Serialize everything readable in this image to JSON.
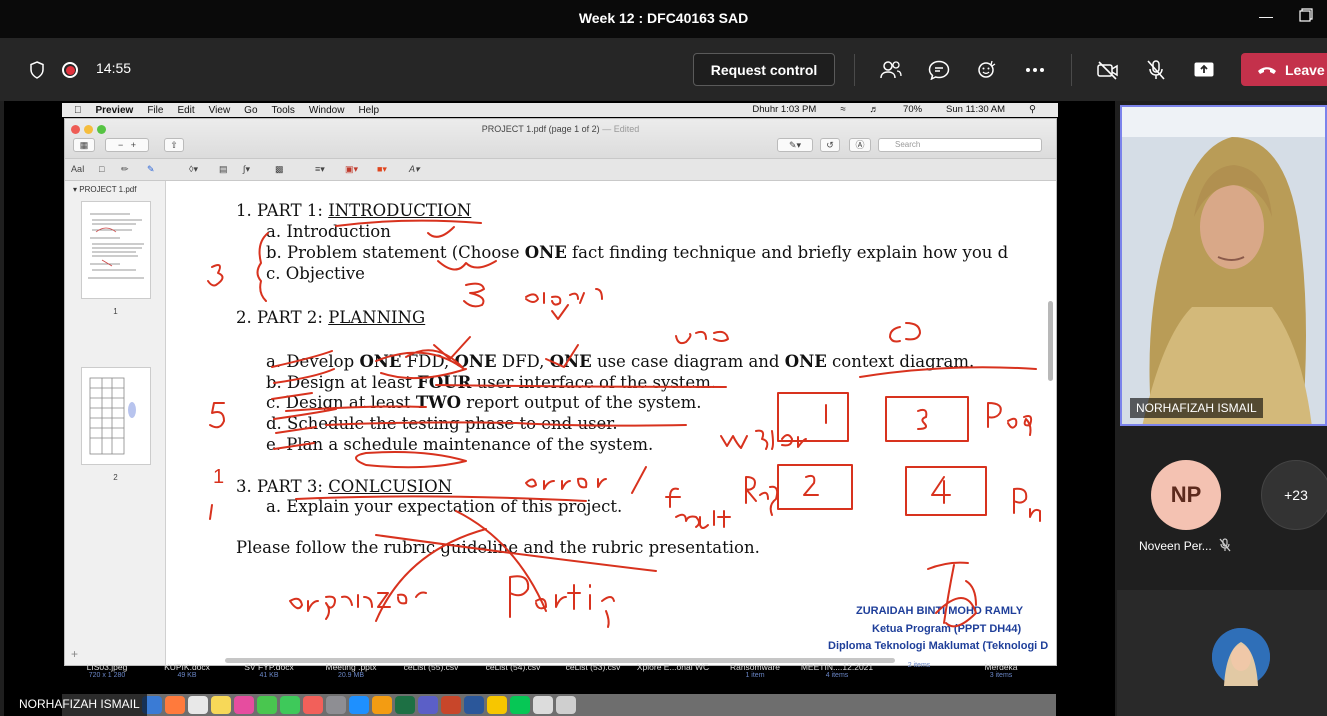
{
  "window": {
    "title": "Week 12 : DFC40163 SAD"
  },
  "toolbar": {
    "timer": "14:55",
    "request_control": "Request control",
    "leave": "Leave"
  },
  "preview": {
    "menubar": [
      "Preview",
      "File",
      "Edit",
      "View",
      "Go",
      "Tools",
      "Window",
      "Help"
    ],
    "status": {
      "prayer": "Dhuhr 1:03 PM",
      "battery": "70%",
      "clock": "Sun 11:30 AM"
    },
    "doc_title": "PROJECT 1.pdf (page 1 of 2)",
    "edited": "— Edited",
    "search_placeholder": "Search",
    "sidebar_file": "PROJECT 1.pdf",
    "pages": [
      "1",
      "2"
    ]
  },
  "document": {
    "part1": {
      "num": "1. PART 1: ",
      "title": "INTRODUCTION"
    },
    "p1a": "a.  Introduction",
    "p1b_pre": "b.  Problem statement (Choose ",
    "p1b_bold": "ONE",
    "p1b_post": " fact finding technique and briefly explain how you d",
    "p1c": "c.  Objective",
    "part2": {
      "num": "2.  PART 2: ",
      "title": "PLANNING"
    },
    "p2a": {
      "t1": "a.  Develop ",
      "b1": "ONE",
      "t2": " FDD, ",
      "b2": "ONE",
      "t3": " DFD, ",
      "b3": "ONE",
      "t4": " use case diagram and ",
      "b4": "ONE",
      "t5": " context diagram."
    },
    "p2b": {
      "t1": "b.  Design at least ",
      "b1": "FOUR",
      "t2": " user interface of the system."
    },
    "p2c": {
      "t1": "c.  Design at least ",
      "b1": "TWO",
      "t2": " report output of the system."
    },
    "p2d": "d.  Schedule the testing phase to end user.",
    "p2e": "e.  Plan a schedule maintenance of the system.",
    "part3": {
      "num": "3.  PART 3: ",
      "title": "CONLCUSION"
    },
    "p3a": "a.  Explain your expectation of this project.",
    "footer": "Please follow the rubric guideline and the rubric presentation.",
    "signature": {
      "name": "ZURAIDAH BINTI MOHD RAMLY",
      "role": "Ketua Program (PPPT DH44)",
      "dept": "Diploma Teknologi Maklumat (Teknologi D"
    },
    "handwriting": [
      "3",
      "3",
      "Objecl",
      "UCD",
      "CD",
      "5",
      "Web",
      "1",
      "3",
      "Pag",
      "Reg",
      "2",
      "4",
      "error",
      "f",
      "fault",
      "Organizer",
      "Partic"
    ]
  },
  "desktop_files": [
    {
      "name": "LIS03.jpeg",
      "sub": "720 x 1 280"
    },
    {
      "name": "KUPIK.docx",
      "sub": "49 KB"
    },
    {
      "name": "SV FYP.docx",
      "sub": "41 KB"
    },
    {
      "name": "Meeting .pptx",
      "sub": "20.9 MB"
    },
    {
      "name": "ceList (55).csv",
      "sub": ""
    },
    {
      "name": "ceList (54).csv",
      "sub": ""
    },
    {
      "name": "ceList (53).csv",
      "sub": ""
    },
    {
      "name": "Xplore E...onal WC",
      "sub": ""
    },
    {
      "name": "Ransomware",
      "sub": "1 item"
    },
    {
      "name": "MEETIN....12.2021",
      "sub": "4 items"
    },
    {
      "name": "",
      "sub": "2 items"
    },
    {
      "name": "Merdeka",
      "sub": "3 items"
    }
  ],
  "presenter": "NORHAFIZAH ISMAIL",
  "participants": {
    "video_name": "NORHAFIZAH ISMAIL",
    "np_initials": "NP",
    "np_name": "Noveen Per...",
    "more": "+23"
  }
}
